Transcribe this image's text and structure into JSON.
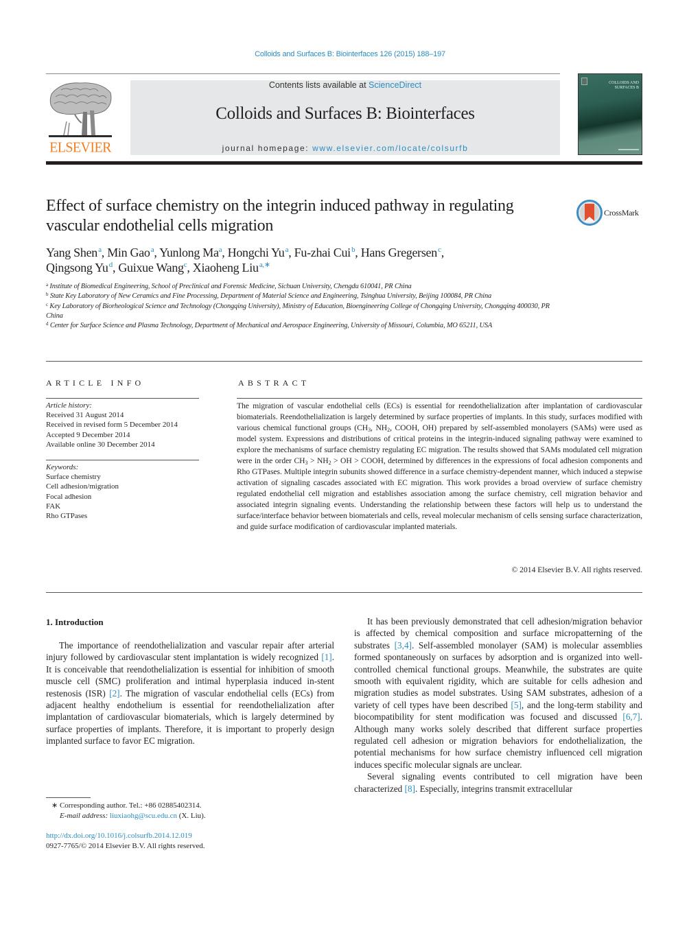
{
  "citation": "Colloids and Surfaces B: Biointerfaces 126 (2015) 188–197",
  "header": {
    "publisher_logo_text": "ELSEVIER",
    "contents_prefix": "Contents lists available at ",
    "contents_link": "ScienceDirect",
    "journal_title": "Colloids and Surfaces B: Biointerfaces",
    "homepage_prefix": "journal homepage: ",
    "homepage_link": "www.elsevier.com/locate/colsurfb",
    "cover_title_line1": "COLLOIDS AND",
    "cover_title_line2": "SURFACES B"
  },
  "crossmark_label": "CrossMark",
  "article": {
    "title": "Effect of surface chemistry on the integrin induced pathway in regulating vascular endothelial cells migration",
    "authors": [
      {
        "name": "Yang Shen",
        "aff": "a"
      },
      {
        "name": "Min Gao",
        "aff": "a"
      },
      {
        "name": "Yunlong Ma",
        "aff": "a"
      },
      {
        "name": "Hongchi Yu",
        "aff": "a"
      },
      {
        "name": "Fu-zhai Cui",
        "aff": "b"
      },
      {
        "name": "Hans Gregersen",
        "aff": "c"
      },
      {
        "name": "Qingsong Yu",
        "aff": "d"
      },
      {
        "name": "Guixue Wang",
        "aff": "c"
      },
      {
        "name": "Xiaoheng Liu",
        "aff": "a,∗"
      }
    ],
    "affiliations": [
      {
        "key": "a",
        "text": "Institute of Biomedical Engineering, School of Preclinical and Forensic Medicine, Sichuan University, Chengdu 610041, PR China"
      },
      {
        "key": "b",
        "text": "State Key Laboratory of New Ceramics and Fine Processing, Department of Material Science and Engineering, Tsinghua University, Beijing 100084, PR China"
      },
      {
        "key": "c",
        "text": "Key Laboratory of Biorheological Science and Technology (Chongqing University), Ministry of Education, Bioengineering College of Chongqing University, Chongqing 400030, PR China"
      },
      {
        "key": "d",
        "text": "Center for Surface Science and Plasma Technology, Department of Mechanical and Aerospace Engineering, University of Missouri, Columbia, MO 65211, USA"
      }
    ]
  },
  "article_info": {
    "heading": "ARTICLE INFO",
    "history_label": "Article history:",
    "history": [
      "Received 31 August 2014",
      "Received in revised form 5 December 2014",
      "Accepted 9 December 2014",
      "Available online 30 December 2014"
    ],
    "keywords_label": "Keywords:",
    "keywords": [
      "Surface chemistry",
      "Cell adhesion/migration",
      "Focal adhesion",
      "FAK",
      "Rho GTPases"
    ]
  },
  "abstract": {
    "heading": "ABSTRACT",
    "part1": "The migration of vascular endothelial cells (ECs) is essential for reendothelialization after implantation of cardiovascular biomaterials. Reendothelialization is largely determined by surface properties of implants. In this study, surfaces modified with various chemical functional groups (CH",
    "part2": ", NH",
    "part3": ", COOH, OH) prepared by self-assembled monolayers (SAMs) were used as model system. Expressions and distributions of critical proteins in the integrin-induced signaling pathway were examined to explore the mechanisms of surface chemistry regulating EC migration. The results showed that SAMs modulated cell migration were in the order CH",
    "part4": " > NH",
    "part5": " > OH > COOH, determined by differences in the expressions of focal adhesion components and Rho GTPases. Multiple integrin subunits showed difference in a surface chemistry-dependent manner, which induced a stepwise activation of signaling cascades associated with EC migration. This work provides a broad overview of surface chemistry regulated endothelial cell migration and establishes association among the surface chemistry, cell migration behavior and associated integrin signaling events. Understanding the relationship between these factors will help us to understand the surface/interface behavior between biomaterials and cells, reveal molecular mechanism of cells sensing surface characterization, and guide surface modification of cardiovascular implanted materials.",
    "sub3": "3",
    "sub2": "2",
    "copyright": "© 2014 Elsevier B.V. All rights reserved."
  },
  "body": {
    "section_heading": "1.  Introduction",
    "left": {
      "p1_a": "The importance of reendothelialization and vascular repair after arterial injury followed by cardiovascular stent implantation is widely recognized ",
      "ref1": "[1]",
      "p1_b": ". It is conceivable that reendothelialization is essential for inhibition of smooth muscle cell (SMC) proliferation and intimal hyperplasia induced in-stent restenosis (ISR) ",
      "ref2": "[2]",
      "p1_c": ". The migration of vascular endothelial cells (ECs) from adjacent healthy endothelium is essential for reendothelialization after implantation of cardiovascular biomaterials, which is largely determined by surface properties of implants. Therefore, it is important to properly design implanted surface to favor EC migration."
    },
    "right": {
      "p1_a": "It has been previously demonstrated that cell adhesion/migration behavior is affected by chemical composition and surface micropatterning of the substrates ",
      "ref34": "[3,4]",
      "p1_b": ". Self-assembled monolayer (SAM) is molecular assemblies formed spontaneously on surfaces by adsorption and is organized into well-controlled chemical functional groups. Meanwhile, the substrates are quite smooth with equivalent rigidity, which are suitable for cells adhesion and migration studies as model substrates. Using SAM substrates, adhesion of a variety of cell types have been described ",
      "ref5": "[5]",
      "p1_c": ", and the long-term stability and biocompatibility for stent modification was focused and discussed ",
      "ref67": "[6,7]",
      "p1_d": ". Although many works solely described that different surface properties regulated cell adhesion or migration behaviors for endothelialization, the potential mechanisms for how surface chemistry influenced cell migration induces specific molecular signals are unclear.",
      "p2_a": "Several signaling events contributed to cell migration have been characterized ",
      "ref8": "[8]",
      "p2_b": ". Especially, integrins transmit extracellular"
    }
  },
  "footnotes": {
    "star": "∗",
    "corresponding": " Corresponding author. Tel.: +86 02885402314.",
    "email_label": "E-mail address: ",
    "email": "liuxiaohg@scu.edu.cn",
    "email_suffix": " (X. Liu).",
    "doi": "http://dx.doi.org/10.1016/j.colsurfb.2014.12.019",
    "issn": "0927-7765/© 2014 Elsevier B.V. All rights reserved."
  },
  "colors": {
    "link": "#2a8cbf",
    "elsevier_orange": "#f07f22",
    "header_band": "#e6e7e8",
    "text": "#231f20"
  }
}
